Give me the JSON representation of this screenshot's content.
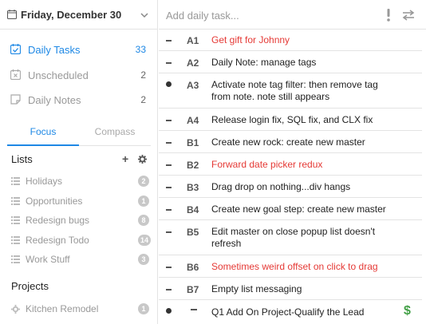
{
  "header": {
    "date": "Friday, December 30"
  },
  "nav": [
    {
      "label": "Daily Tasks",
      "count": "33",
      "icon": "checkbox-calendar-icon"
    },
    {
      "label": "Unscheduled",
      "count": "2",
      "icon": "calendar-x-icon"
    },
    {
      "label": "Daily Notes",
      "count": "2",
      "icon": "note-icon"
    }
  ],
  "tabs": {
    "focus": "Focus",
    "compass": "Compass"
  },
  "lists": {
    "title": "Lists",
    "items": [
      {
        "label": "Holidays",
        "badge": "2"
      },
      {
        "label": "Opportunities",
        "badge": "1"
      },
      {
        "label": "Redesign bugs",
        "badge": "8"
      },
      {
        "label": "Redesign Todo",
        "badge": "14"
      },
      {
        "label": "Work Stuff",
        "badge": "3"
      }
    ]
  },
  "projects": {
    "title": "Projects",
    "items": [
      {
        "label": "Kitchen Remodel",
        "badge": "1"
      }
    ]
  },
  "add_task": {
    "placeholder": "Add daily task..."
  },
  "tasks": [
    {
      "code": "A1",
      "title": "Get gift for Johnny",
      "color": "#e53935"
    },
    {
      "code": "A2",
      "title": "Daily Note: manage tags",
      "color": "#222222"
    },
    {
      "code": "A3",
      "title": "Activate note tag filter: then remove tag from note. note still appears",
      "color": "#222222"
    },
    {
      "code": "A4",
      "title": "Release login fix, SQL fix, and CLX fix",
      "color": "#222222"
    },
    {
      "code": "B1",
      "title": "Create new rock: create new master",
      "color": "#222222"
    },
    {
      "code": "B2",
      "title": "Forward date picker redux",
      "color": "#e53935"
    },
    {
      "code": "B3",
      "title": "Drag drop on nothing...div hangs",
      "color": "#222222"
    },
    {
      "code": "B4",
      "title": "Create new goal step: create new master",
      "color": "#222222"
    },
    {
      "code": "B5",
      "title": "Edit master on close popup list doesn't refresh",
      "color": "#222222"
    },
    {
      "code": "B6",
      "title": "Sometimes weird offset on click to drag",
      "color": "#e53935"
    },
    {
      "code": "B7",
      "title": "Empty list messaging",
      "color": "#222222"
    },
    {
      "code": "",
      "title": "Q1 Add On Project-Qualify the Lead",
      "color": "#222222"
    }
  ],
  "colors": {
    "accent": "#1e88e5",
    "urgent": "#e53935",
    "money": "#43a047"
  }
}
